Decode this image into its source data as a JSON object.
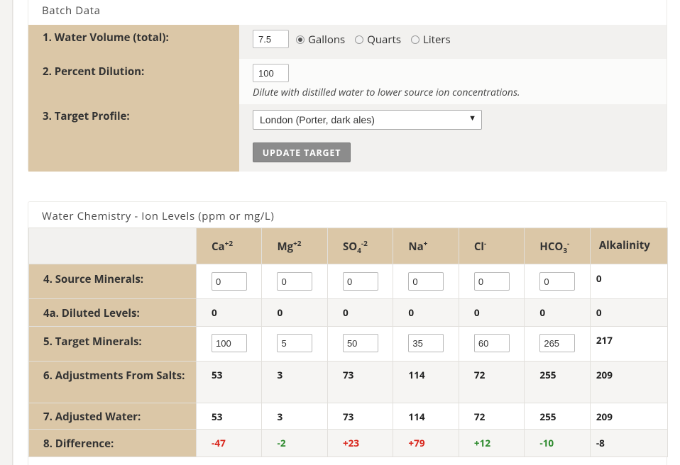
{
  "batch": {
    "title": "Batch Data",
    "rows": {
      "volume_label": "1. Water Volume (total):",
      "volume_value": "7.5",
      "units": [
        "Gallons",
        "Quarts",
        "Liters"
      ],
      "selected_unit": "Gallons",
      "dilution_label": "2. Percent Dilution:",
      "dilution_value": "100",
      "dilution_hint": "Dilute with distilled water to lower source ion concentrations.",
      "profile_label": "3. Target Profile:",
      "profile_value": "London (Porter, dark ales)",
      "update_button": "UPDATE TARGET"
    }
  },
  "chem": {
    "title": "Water Chemistry - Ion Levels (ppm or mg/L)",
    "headers": [
      {
        "base": "Ca",
        "sup": "+2",
        "sub": ""
      },
      {
        "base": "Mg",
        "sup": "+2",
        "sub": ""
      },
      {
        "base": "SO",
        "sup": "-2",
        "sub": "4"
      },
      {
        "base": "Na",
        "sup": "+",
        "sub": ""
      },
      {
        "base": "Cl",
        "sup": "-",
        "sub": ""
      },
      {
        "base": "HCO",
        "sup": "-",
        "sub": "3"
      },
      {
        "base": "Alkalinity",
        "sup": "",
        "sub": ""
      }
    ],
    "rows": [
      {
        "label": "4. Source Minerals:",
        "type": "input",
        "values": [
          "0",
          "0",
          "0",
          "0",
          "0",
          "0"
        ],
        "alkalinity": "0"
      },
      {
        "label": "4a. Diluted Levels:",
        "type": "text",
        "values": [
          "0",
          "0",
          "0",
          "0",
          "0",
          "0"
        ],
        "alkalinity": "0"
      },
      {
        "label": "5. Target Minerals:",
        "type": "input",
        "values": [
          "100",
          "5",
          "50",
          "35",
          "60",
          "265"
        ],
        "alkalinity": "217"
      },
      {
        "label": "6. Adjustments From Salts:",
        "type": "text",
        "values": [
          "53",
          "3",
          "73",
          "114",
          "72",
          "255"
        ],
        "alkalinity": "209"
      },
      {
        "label": "7. Adjusted Water:",
        "type": "text",
        "values": [
          "53",
          "3",
          "73",
          "114",
          "72",
          "255"
        ],
        "alkalinity": "209"
      },
      {
        "label": "8. Difference:",
        "type": "diff",
        "values": [
          "-47",
          "-2",
          "+23",
          "+79",
          "+12",
          "-10"
        ],
        "alkalinity": "-8"
      }
    ],
    "diff_colors": [
      "red",
      "green",
      "red",
      "red",
      "green",
      "green",
      "black"
    ]
  },
  "colors": {
    "label_bg": "#dbc7a7",
    "button_bg": "#8c8c8c",
    "negative": "#d9261c",
    "positive": "#2e8a2e"
  }
}
